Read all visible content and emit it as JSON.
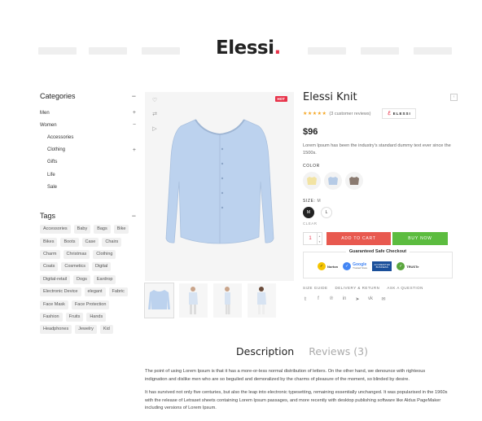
{
  "header": {
    "logo_text": "Elessi",
    "logo_dot": "."
  },
  "sidebar": {
    "categories_title": "Categories",
    "categories": [
      {
        "label": "Men",
        "toggle": "+",
        "sub": false
      },
      {
        "label": "Women",
        "toggle": "−",
        "sub": false
      },
      {
        "label": "Accessories",
        "toggle": "",
        "sub": true
      },
      {
        "label": "Clothing",
        "toggle": "+",
        "sub": true
      },
      {
        "label": "Gifts",
        "toggle": "",
        "sub": true
      },
      {
        "label": "Life",
        "toggle": "",
        "sub": true
      },
      {
        "label": "Sale",
        "toggle": "",
        "sub": true
      }
    ],
    "tags_title": "Tags",
    "tags": [
      "Accessories",
      "Baby",
      "Bags",
      "Bike",
      "Bikes",
      "Boots",
      "Case",
      "Chairs",
      "Charm",
      "Christmas",
      "Clothing",
      "Coats",
      "Cosmetics",
      "Digital",
      "Digital-retail",
      "Dogs",
      "Eardrop",
      "Electronic Device",
      "elegant",
      "Fabric",
      "Face Mask",
      "Face Protection",
      "Fashion",
      "Fruits",
      "Hands",
      "Headphones",
      "Jewelry",
      "Kid"
    ]
  },
  "gallery": {
    "hot_badge": "HOT"
  },
  "product": {
    "title": "Elessi Knit",
    "stars": "★★★★★",
    "reviews_link": "(3 customer reviews)",
    "brand": "ELESSI",
    "price": "$96",
    "description": "Lorem Ipsum has been the industry's standard dummy text ever since the 1500s.",
    "color_label": "COLOR",
    "colors": [
      "#f2e3a2",
      "#b6cbe6",
      "#8a7a70"
    ],
    "size_label": "SIZE:",
    "size_selected": "M",
    "sizes": [
      "M",
      "L"
    ],
    "clear_label": "CLEAR",
    "quantity": "1",
    "add_to_cart": "ADD TO CART",
    "buy_now": "BUY NOW",
    "safe_checkout": "Guaranteed Safe Checkout",
    "badges": {
      "norton": "Norton",
      "google": "Google",
      "google_sub": "Trusted Store",
      "bbb": "ACCREDITED BUSINESS",
      "truste": "TRUSTe"
    },
    "links": [
      "SIZE GUIDE",
      "DELIVERY & RETURN",
      "ASK A QUESTION"
    ],
    "social_icons": [
      "twitter-icon",
      "facebook-icon",
      "pinterest-icon",
      "linkedin-icon",
      "telegram-icon",
      "vk-icon",
      "email-icon"
    ]
  },
  "tabs": {
    "description": "Description",
    "reviews": "Reviews (3)",
    "paragraph1": "The point of using Lorem Ipsum is that it has a more-or-less normal distribution of letters. On the other hand, we denounce with righteous indignation and dislike men who are so beguiled and demoralized by the charms of pleasure of the moment, so blinded by desire.",
    "paragraph2": "It has survived not only five centuries, but also the leap into electronic typesetting, remaining essentially unchanged. It was popularised in the 1960s with the release of Letraset sheets containing Lorem Ipsum passages, and more recently with desktop publishing software like Aldus PageMaker including versions of Lorem Ipsum."
  }
}
